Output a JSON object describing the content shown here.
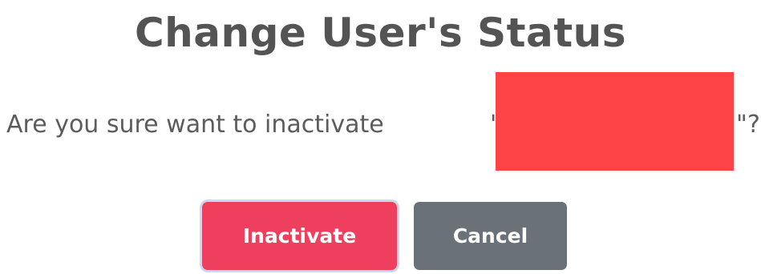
{
  "dialog": {
    "title": "Change User's Status",
    "message_prefix": "Are you sure want to inactivate",
    "quote_open": "\"",
    "quote_close": "\"",
    "message_suffix": "?",
    "redaction_color": "#fe4346",
    "buttons": {
      "inactivate_label": "Inactivate",
      "cancel_label": "Cancel"
    },
    "colors": {
      "inactivate": "#ef3f5e",
      "cancel": "#6b7178",
      "title": "#545454"
    }
  }
}
